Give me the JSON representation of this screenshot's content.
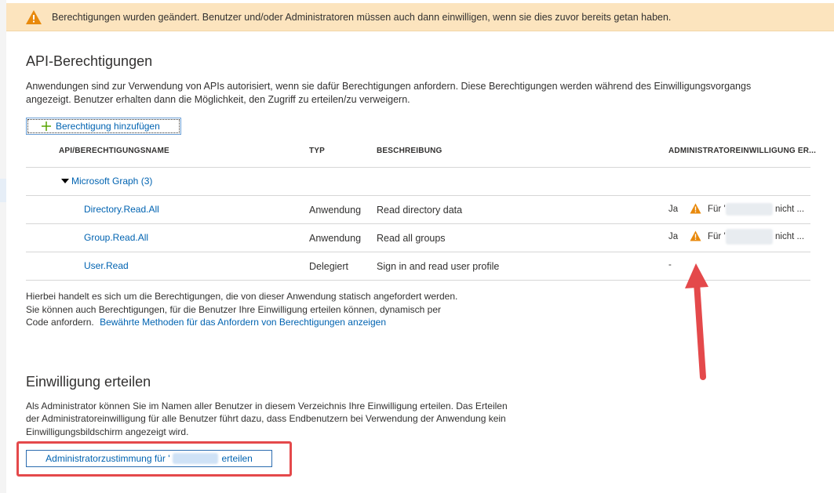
{
  "banner": {
    "message": "Berechtigungen wurden geändert. Benutzer und/oder Administratoren müssen auch dann einwilligen, wenn sie dies zuvor bereits getan haben."
  },
  "api_section": {
    "title": "API-Berechtigungen",
    "description_line1": "Anwendungen sind zur Verwendung von APIs autorisiert, wenn sie dafür Berechtigungen anfordern. Diese Berechtigungen werden während des Einwilligungsvorgangs",
    "description_line2": "angezeigt. Benutzer erhalten dann die Möglichkeit, den Zugriff zu erteilen/zu verweigern.",
    "add_button_label": "Berechtigung hinzufügen"
  },
  "table": {
    "headers": {
      "name": "API/BERECHTIGUNGSNAME",
      "type": "TYP",
      "description": "BESCHREIBUNG",
      "admin_consent": "ADMINISTRATOREINWILLIGUNG ER..."
    },
    "group": {
      "label": "Microsoft Graph (3)"
    },
    "rows": [
      {
        "name": "Directory.Read.All",
        "type": "Anwendung",
        "description": "Read directory data",
        "admin": "Ja",
        "status_prefix": "Für '",
        "status_suffix": "nicht ..."
      },
      {
        "name": "Group.Read.All",
        "type": "Anwendung",
        "description": "Read all groups",
        "admin": "Ja",
        "status_prefix": "Für '",
        "status_suffix": "nicht ..."
      },
      {
        "name": "User.Read",
        "type": "Delegiert",
        "description": "Sign in and read user profile",
        "admin": "-",
        "status_prefix": "",
        "status_suffix": ""
      }
    ]
  },
  "footer_note": {
    "line1": "Hierbei handelt es sich um die Berechtigungen, die von dieser Anwendung statisch angefordert werden.",
    "line2": "Sie können auch Berechtigungen, für die Benutzer Ihre Einwilligung erteilen können, dynamisch per",
    "line3_text": "Code anfordern.",
    "line3_link": "Bewährte Methoden für das Anfordern von Berechtigungen anzeigen"
  },
  "consent_section": {
    "title": "Einwilligung erteilen",
    "line1": "Als Administrator können Sie im Namen aller Benutzer in diesem Verzeichnis Ihre Einwilligung erteilen. Das Erteilen",
    "line2": "der Administratoreinwilligung für alle Benutzer führt dazu, dass Endbenutzern bei Verwendung der Anwendung kein",
    "line3": "Einwilligungsbildschirm angezeigt wird.",
    "button_prefix": "Administratorzustimmung für '",
    "button_suffix": "erteilen"
  },
  "colors": {
    "banner_bg": "#fce4be",
    "warning": "#e8890c",
    "link": "#0063b1",
    "annotation_red": "#e4494b"
  }
}
